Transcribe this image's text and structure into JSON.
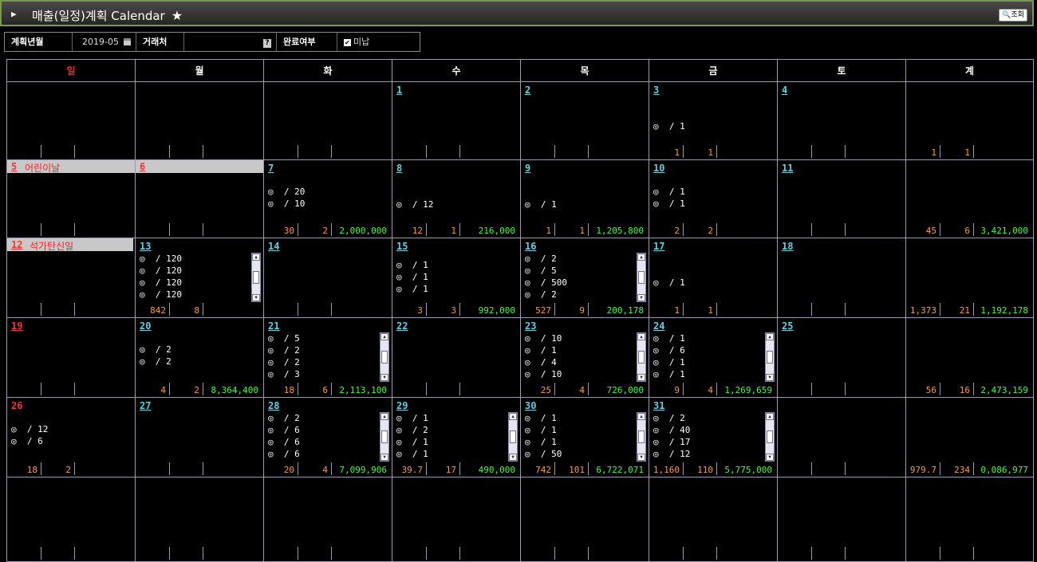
{
  "title": {
    "text": "매출(일정)계획 Calendar",
    "star": "★",
    "search_button": "조회"
  },
  "filter": {
    "plan_month_label": "계획년월",
    "plan_month_value": "2019-05",
    "customer_label": "거래처",
    "customer_value": "",
    "done_label": "완료여부",
    "done_option": "미납"
  },
  "headers": [
    {
      "label": "일",
      "color": "#ff2020"
    },
    {
      "label": "월",
      "color": "#ffffff"
    },
    {
      "label": "화",
      "color": "#ffffff"
    },
    {
      "label": "수",
      "color": "#ffffff"
    },
    {
      "label": "목",
      "color": "#ffffff"
    },
    {
      "label": "금",
      "color": "#ffffff"
    },
    {
      "label": "토",
      "color": "#ffffff"
    },
    {
      "label": "계",
      "color": "#ffffff"
    }
  ],
  "weeks": [
    [
      null,
      null,
      null,
      {
        "day": "1"
      },
      {
        "day": "2"
      },
      {
        "day": "3",
        "lines": [
          "◎  / 1"
        ],
        "cnt1": "1",
        "cnt2": "1"
      },
      {
        "day": "4"
      },
      {
        "total": true,
        "cnt1": "1",
        "cnt2": "1"
      }
    ],
    [
      {
        "day": "5",
        "holiday": "어린이날",
        "red": true,
        "hw": 160
      },
      {
        "day": "6",
        "holiday": "",
        "red": true,
        "hw": 160
      },
      {
        "day": "7",
        "lines": [
          "◎  / 20",
          "◎  / 10"
        ],
        "cnt1": "30",
        "cnt2": "2",
        "amt": "2,000,000"
      },
      {
        "day": "8",
        "lines": [
          "◎  / 12"
        ],
        "cnt1": "12",
        "cnt2": "1",
        "amt": "216,000"
      },
      {
        "day": "9",
        "lines": [
          "◎  / 1"
        ],
        "cnt1": "1",
        "cnt2": "1",
        "amt": "1,205,800"
      },
      {
        "day": "10",
        "lines": [
          "◎  / 1",
          "◎  / 1"
        ],
        "cnt1": "2",
        "cnt2": "2"
      },
      {
        "day": "11"
      },
      {
        "total": true,
        "cnt1": "45",
        "cnt2": "6",
        "amt": "3,421,000"
      }
    ],
    [
      {
        "day": "12",
        "holiday": "석가탄신일",
        "red": true,
        "hw": 158
      },
      {
        "day": "13",
        "lines": [
          "◎  / 120",
          "◎  / 120",
          "◎  / 120",
          "◎  / 120"
        ],
        "scroll": true,
        "cnt1": "842",
        "cnt2": "8"
      },
      {
        "day": "14"
      },
      {
        "day": "15",
        "lines": [
          "◎  / 1",
          "◎  / 1",
          "◎  / 1"
        ],
        "cnt1": "3",
        "cnt2": "3",
        "amt": "992,000"
      },
      {
        "day": "16",
        "lines": [
          "◎  / 2",
          "◎  / 5",
          "◎  / 500",
          "◎  / 2"
        ],
        "scroll": true,
        "cnt1": "527",
        "cnt2": "9",
        "amt": "200,178"
      },
      {
        "day": "17",
        "lines": [
          "◎  / 1"
        ],
        "cnt1": "1",
        "cnt2": "1"
      },
      {
        "day": "18"
      },
      {
        "total": true,
        "cnt1": "1,373",
        "cnt2": "21",
        "amt": "1,192,178"
      }
    ],
    [
      {
        "day": "19",
        "red": true
      },
      {
        "day": "20",
        "lines": [
          "◎  / 2",
          "◎  / 2"
        ],
        "cnt1": "4",
        "cnt2": "2",
        "amt": "8,364,400"
      },
      {
        "day": "21",
        "lines": [
          "◎  / 5",
          "◎  / 2",
          "◎  / 2",
          "◎  / 3"
        ],
        "scroll": true,
        "cnt1": "18",
        "cnt2": "6",
        "amt": "2,113,100"
      },
      {
        "day": "22"
      },
      {
        "day": "23",
        "lines": [
          "◎  / 10",
          "◎  / 1",
          "◎  / 4",
          "◎  / 10"
        ],
        "scroll": true,
        "cnt1": "25",
        "cnt2": "4",
        "amt": "726,000"
      },
      {
        "day": "24",
        "lines": [
          "◎  / 1",
          "◎  / 6",
          "◎  / 1",
          "◎  / 1"
        ],
        "scroll": true,
        "cnt1": "9",
        "cnt2": "4",
        "amt": "1,269,659"
      },
      {
        "day": "25"
      },
      {
        "total": true,
        "cnt1": "56",
        "cnt2": "16",
        "amt": "2,473,159"
      }
    ],
    [
      {
        "day": "26",
        "red": true,
        "nounder": true,
        "lines": [
          "◎  / 12",
          "◎  / 6"
        ],
        "cnt1": "18",
        "cnt2": "2"
      },
      {
        "day": "27"
      },
      {
        "day": "28",
        "lines": [
          "◎  / 2",
          "◎  / 6",
          "◎  / 6",
          "◎  / 6"
        ],
        "scroll": true,
        "cnt1": "20",
        "cnt2": "4",
        "amt": "7,099,906"
      },
      {
        "day": "29",
        "lines": [
          "◎  / 1",
          "◎  / 2",
          "◎  / 1",
          "◎  / 1"
        ],
        "scroll": true,
        "cnt1": "39.7",
        "cnt2": "17",
        "amt": "490,000"
      },
      {
        "day": "30",
        "lines": [
          "◎  / 1",
          "◎  / 1",
          "◎  / 1",
          "◎  / 50"
        ],
        "scroll": true,
        "cnt1": "742",
        "cnt2": "101",
        "amt": "6,722,071"
      },
      {
        "day": "31",
        "lines": [
          "◎  / 2",
          "◎  / 40",
          "◎  / 17",
          "◎  / 12"
        ],
        "scroll": true,
        "cnt1": "1,160",
        "cnt2": "110",
        "amt": "5,775,000"
      },
      {},
      {
        "total": true,
        "cnt1": "979.7",
        "cnt2": "234",
        "amt": "0,086,977"
      }
    ],
    [
      {},
      {},
      {},
      {},
      {},
      {},
      {},
      {
        "total": true
      }
    ]
  ]
}
